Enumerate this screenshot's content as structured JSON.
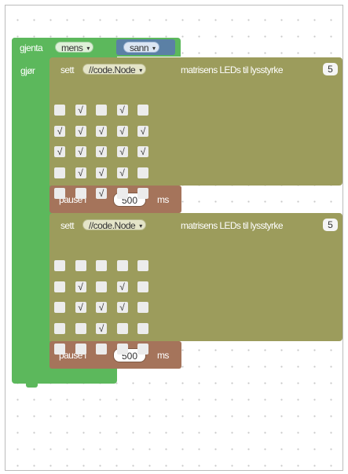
{
  "loop": {
    "keyword": "gjenta",
    "mode": "mens",
    "do_label": "gjør"
  },
  "condition": {
    "value": "sann"
  },
  "led_blocks": [
    {
      "set_label": "sett",
      "target": "//code.Node",
      "suffix": "matrisens LEDs til lysstyrke",
      "brightness": "5",
      "grid": [
        [
          0,
          1,
          0,
          1,
          0
        ],
        [
          1,
          1,
          1,
          1,
          1
        ],
        [
          1,
          1,
          1,
          1,
          1
        ],
        [
          0,
          1,
          1,
          1,
          0
        ],
        [
          0,
          0,
          1,
          0,
          0
        ]
      ]
    },
    {
      "set_label": "sett",
      "target": "//code.Node",
      "suffix": "matrisens LEDs til lysstyrke",
      "brightness": "5",
      "grid": [
        [
          0,
          0,
          0,
          0,
          0
        ],
        [
          0,
          1,
          0,
          1,
          0
        ],
        [
          0,
          1,
          1,
          1,
          0
        ],
        [
          0,
          0,
          1,
          0,
          0
        ],
        [
          0,
          0,
          0,
          0,
          0
        ]
      ]
    }
  ],
  "pause_blocks": [
    {
      "label": "pause i",
      "value": "500",
      "unit": "ms"
    },
    {
      "label": "pause i",
      "value": "500",
      "unit": "ms"
    }
  ],
  "check_glyph": "√",
  "dropdown_arrow": "▾",
  "colors": {
    "loop": "#5cb85c",
    "boolean": "#5b80a5",
    "led": "#9c9c5c",
    "pause": "#a5745b"
  }
}
